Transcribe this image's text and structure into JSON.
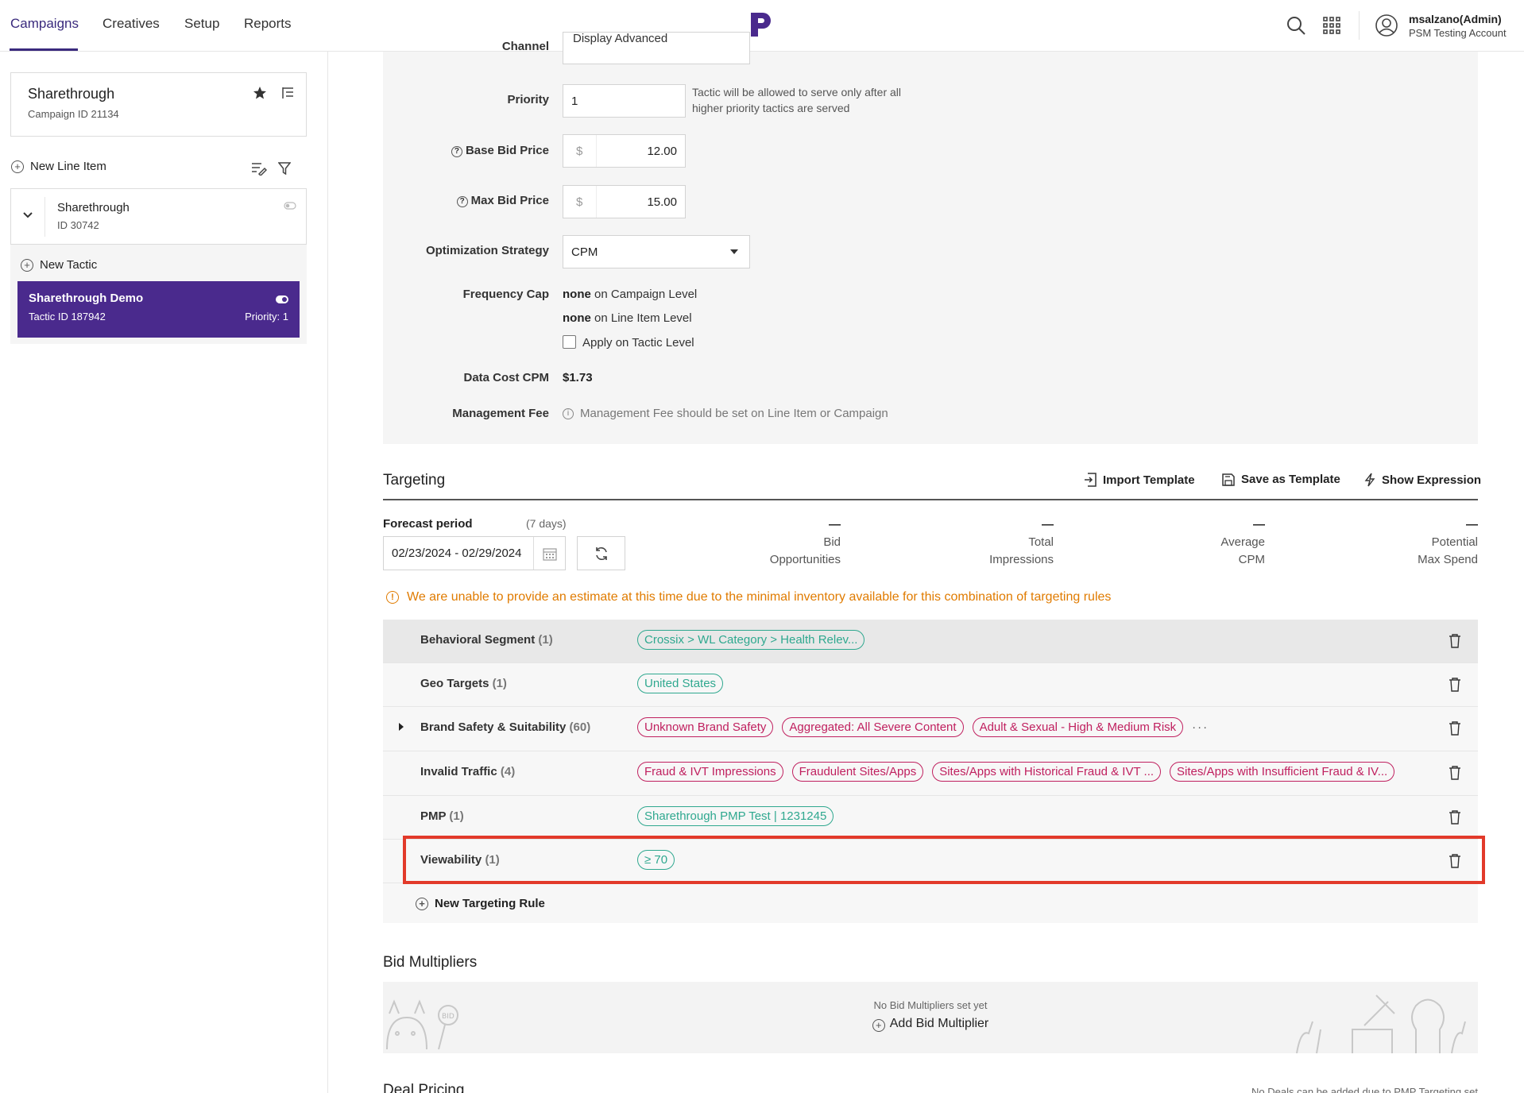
{
  "nav": {
    "tabs": [
      {
        "label": "Campaigns"
      },
      {
        "label": "Creatives"
      },
      {
        "label": "Setup"
      },
      {
        "label": "Reports"
      }
    ],
    "user": {
      "name": "msalzano(Admin)",
      "account": "PSM Testing Account"
    }
  },
  "sidebar": {
    "campaign": {
      "name": "Sharethrough",
      "id_text": "Campaign ID 21134"
    },
    "new_line_item": "New Line Item",
    "line_item": {
      "name": "Sharethrough",
      "id_text": "ID 30742"
    },
    "new_tactic": "New Tactic",
    "tactic": {
      "name": "Sharethrough Demo",
      "id_text": "Tactic ID 187942",
      "priority": "Priority: 1"
    }
  },
  "settings": {
    "channel_label": "Channel",
    "channel_value": "Display Advanced",
    "priority_label": "Priority",
    "priority_value": "1",
    "priority_note_1": "Tactic will be allowed to serve only after all",
    "priority_note_2": "higher priority tactics are served",
    "base_bid_label": "Base Bid Price",
    "base_bid_currency": "$",
    "base_bid_value": "12.00",
    "max_bid_label": "Max Bid Price",
    "max_bid_currency": "$",
    "max_bid_value": "15.00",
    "opt_label": "Optimization Strategy",
    "opt_value": "CPM",
    "freq_label": "Frequency Cap",
    "freq_campaign_value": "none",
    "freq_campaign_level": "on Campaign Level",
    "freq_li_value": "none",
    "freq_li_level": "on Line Item Level",
    "freq_apply": "Apply on Tactic Level",
    "data_cost_label": "Data Cost CPM",
    "data_cost_value": "$1.73",
    "mgmt_fee_label": "Management Fee",
    "mgmt_fee_note": "Management Fee should be set on Line Item or Campaign"
  },
  "targeting": {
    "title": "Targeting",
    "tools": {
      "import": "Import Template",
      "save": "Save as Template",
      "show": "Show Expression"
    },
    "forecast_label": "Forecast period",
    "forecast_days": "(7 days)",
    "date_range": "02/23/2024 - 02/29/2024",
    "metrics": [
      {
        "value": "—",
        "line1": "Bid",
        "line2": "Opportunities"
      },
      {
        "value": "—",
        "line1": "Total",
        "line2": "Impressions"
      },
      {
        "value": "—",
        "line1": "Average",
        "line2": "CPM"
      },
      {
        "value": "—",
        "line1": "Potential",
        "line2": "Max Spend"
      }
    ],
    "warning": "We are unable to provide an estimate at this time due to the minimal inventory available for this combination of targeting rules",
    "rules": [
      {
        "name": "Behavioral Segment",
        "count": "(1)",
        "chips": [
          "Crossix > WL Category > Health Relev..."
        ]
      },
      {
        "name": "Geo Targets",
        "count": "(1)",
        "chips": [
          "United States"
        ]
      },
      {
        "name": "Brand Safety & Suitability",
        "count": "(60)",
        "chips": [
          "Unknown Brand Safety",
          "Aggregated: All Severe Content",
          "Adult & Sexual - High & Medium Risk"
        ],
        "more": "···"
      },
      {
        "name": "Invalid Traffic",
        "count": "(4)",
        "chips": [
          "Fraud & IVT Impressions",
          "Fraudulent Sites/Apps",
          "Sites/Apps with Historical Fraud & IVT ...",
          "Sites/Apps with Insufficient Fraud & IV..."
        ]
      },
      {
        "name": "PMP",
        "count": "(1)",
        "chips": [
          "Sharethrough PMP Test | 1231245"
        ]
      },
      {
        "name": "Viewability",
        "count": "(1)",
        "chips": [
          "≥ 70"
        ]
      }
    ],
    "new_rule": "New Targeting Rule"
  },
  "bid_multipliers": {
    "title": "Bid Multipliers",
    "empty": "No Bid Multipliers set yet",
    "add": "Add Bid Multiplier"
  },
  "deal_pricing": {
    "title": "Deal Pricing",
    "note": "No Deals can be added due to PMP Targeting set"
  },
  "colors": {
    "brand": "#4a2a8d",
    "warning": "#e07b00",
    "chip_green": "#2fa88f",
    "chip_pink": "#c0205f",
    "highlight": "#e23a2a"
  }
}
